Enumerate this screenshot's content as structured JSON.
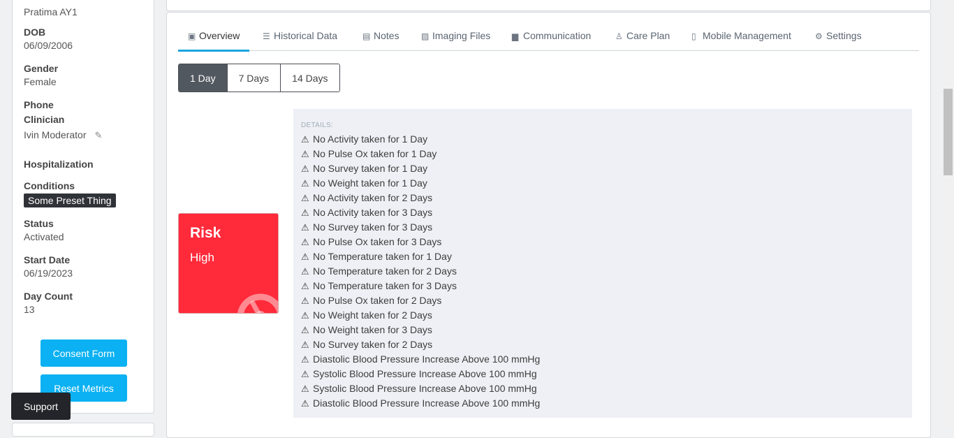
{
  "patient": {
    "name": "Pratima AY1",
    "dob_label": "DOB",
    "dob": "06/09/2006",
    "gender_label": "Gender",
    "gender": "Female",
    "phone_label": "Phone",
    "clinician_label": "Clinician",
    "clinician": "Ivin Moderator",
    "hospitalization_label": "Hospitalization",
    "conditions_label": "Conditions",
    "condition_tag": "Some Preset Thing",
    "status_label": "Status",
    "status": "Activated",
    "start_date_label": "Start Date",
    "start_date": "06/19/2023",
    "day_count_label": "Day Count",
    "day_count": "13"
  },
  "buttons": {
    "consent": "Consent Form",
    "reset": "Reset Metrics",
    "support": "Support"
  },
  "tabs": [
    {
      "label": "Overview",
      "icon": "id-card-icon"
    },
    {
      "label": "Historical Data",
      "icon": "database-icon"
    },
    {
      "label": "Notes",
      "icon": "clipboard-icon"
    },
    {
      "label": "Imaging Files",
      "icon": "image-icon"
    },
    {
      "label": "Communication",
      "icon": "comments-icon"
    },
    {
      "label": "Care Plan",
      "icon": "user-icon"
    },
    {
      "label": "Mobile Management",
      "icon": "mobile-icon"
    },
    {
      "label": "Settings",
      "icon": "gear-icon"
    }
  ],
  "active_tab": "Overview",
  "range": [
    "1 Day",
    "7 Days",
    "14 Days"
  ],
  "active_range": "1 Day",
  "risk": {
    "title": "Risk",
    "level": "High",
    "color": "#ff2a3a"
  },
  "details_label": "DETAILS:",
  "alerts": [
    "No Activity taken for 1 Day",
    "No Pulse Ox taken for 1 Day",
    "No Survey taken for 1 Day",
    "No Weight taken for 1 Day",
    "No Activity taken for 2 Days",
    "No Activity taken for 3 Days",
    "No Survey taken for 3 Days",
    "No Pulse Ox taken for 3 Days",
    "No Temperature taken for 1 Day",
    "No Temperature taken for 2 Days",
    "No Temperature taken for 3 Days",
    "No Pulse Ox taken for 2 Days",
    "No Weight taken for 2 Days",
    "No Weight taken for 3 Days",
    "No Survey taken for 2 Days",
    "Diastolic Blood Pressure Increase Above 100 mmHg",
    "Systolic Blood Pressure Increase Above 100 mmHg",
    "Systolic Blood Pressure Increase Above 100 mmHg",
    "Diastolic Blood Pressure Increase Above 100 mmHg"
  ],
  "colors": {
    "accent": "#0bb1f2",
    "active_tab_underline": "#1aa4e0",
    "dark": "#24252a"
  }
}
